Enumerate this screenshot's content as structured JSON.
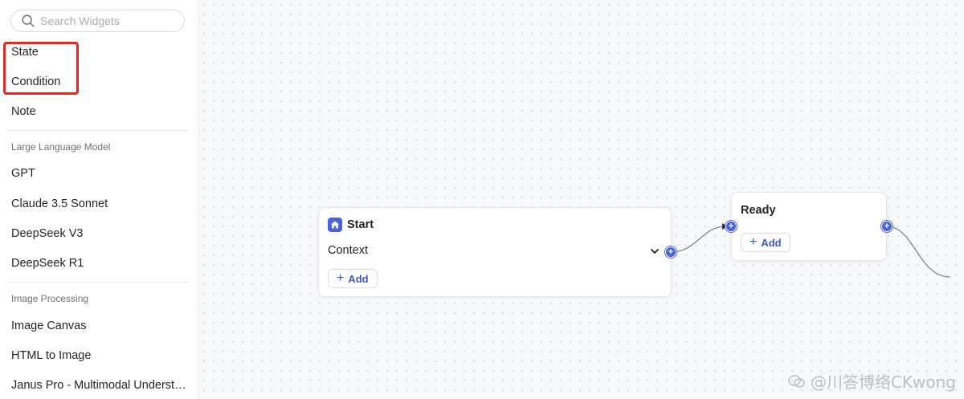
{
  "search": {
    "placeholder": "Search Widgets"
  },
  "sidebar": {
    "top_items": [
      {
        "label": "State"
      },
      {
        "label": "Condition"
      },
      {
        "label": "Note"
      }
    ],
    "sections": [
      {
        "title": "Large Language Model",
        "items": [
          {
            "label": "GPT"
          },
          {
            "label": "Claude 3.5 Sonnet"
          },
          {
            "label": "DeepSeek V3"
          },
          {
            "label": "DeepSeek R1"
          }
        ]
      },
      {
        "title": "Image Processing",
        "items": [
          {
            "label": "Image Canvas"
          },
          {
            "label": "HTML to Image"
          },
          {
            "label": "Janus Pro - Multimodal Understanding"
          }
        ]
      }
    ]
  },
  "canvas": {
    "start_node": {
      "title": "Start",
      "icon": "home-icon",
      "field_label": "Context",
      "add_label": "Add"
    },
    "ready_node": {
      "title": "Ready",
      "add_label": "Add"
    }
  },
  "watermark": {
    "text": "@川答博络CKwong"
  },
  "colors": {
    "accent": "#4a62d8",
    "highlight": "#e8281f"
  }
}
